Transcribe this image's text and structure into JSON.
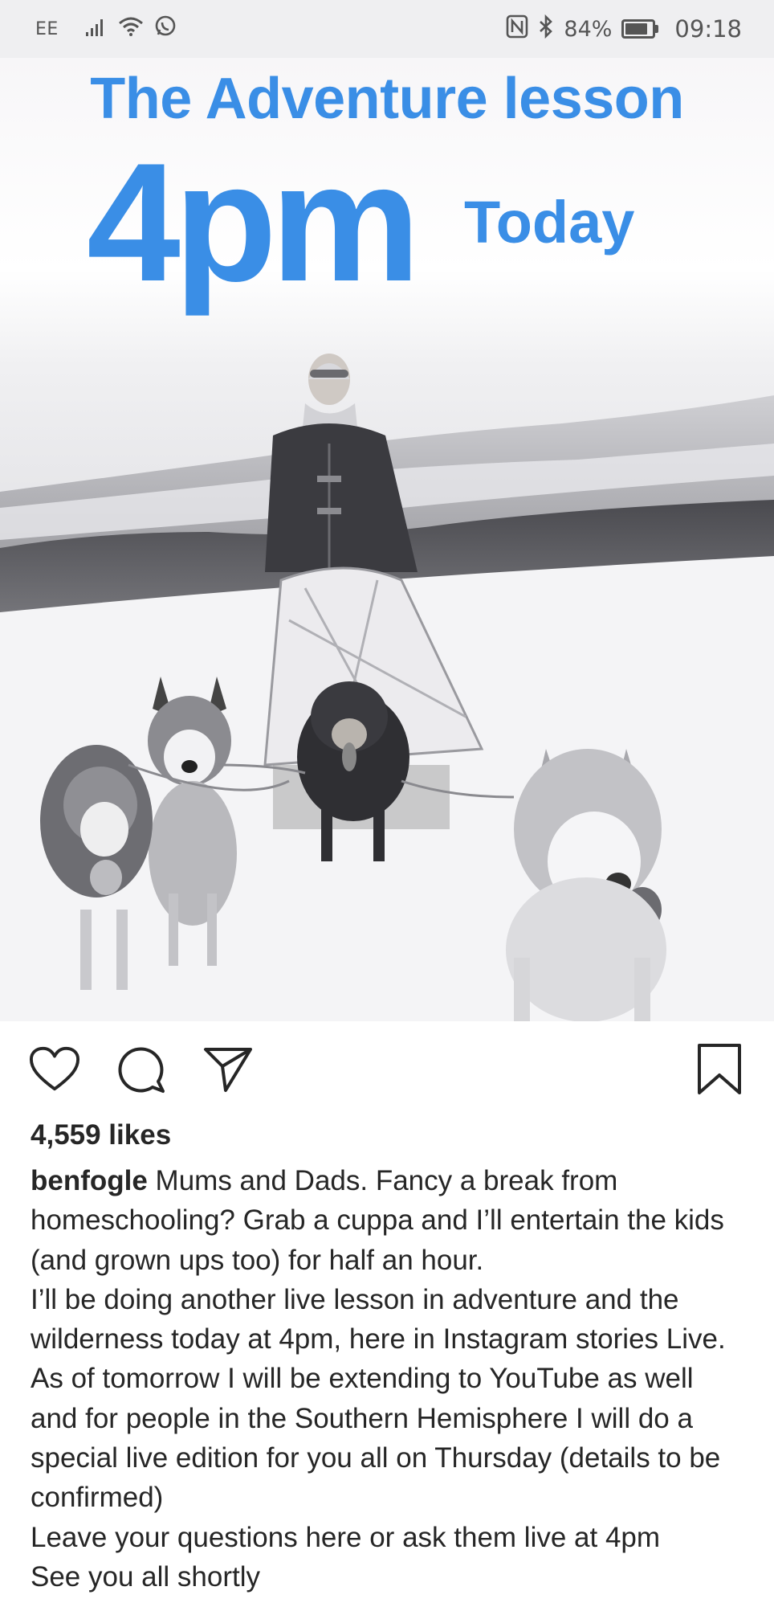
{
  "status_bar": {
    "carrier": "EE",
    "battery_percent": "84%",
    "battery_level": 0.84,
    "time": "09:18",
    "icons": [
      "signal-icon",
      "wifi-icon",
      "whatsapp-icon",
      "nfc-icon",
      "bluetooth-icon",
      "battery-icon"
    ]
  },
  "post": {
    "image": {
      "overlay_title": "The Adventure lesson",
      "overlay_time": "4pm",
      "overlay_today": "Today",
      "scene": "Black-and-white photo of a man on a dog sled pulled by huskies across snow"
    },
    "actions": {
      "like_icon": "heart-icon",
      "comment_icon": "comment-icon",
      "share_icon": "send-icon",
      "save_icon": "bookmark-icon"
    },
    "likes": "4,559 likes",
    "username": "benfogle",
    "caption_first": " Mums and Dads. Fancy a break from homeschooling? Grab a cuppa and I’ll entertain the kids (and grown ups too) for half an hour.",
    "caption_paragraphs": [
      "I’ll be doing another live lesson in adventure and the wilderness today at 4pm, here in Instagram stories Live. As of tomorrow I will be extending to YouTube as well and for people in the Southern Hemisphere I will do a special live edition for you all on Thursday (details to be confirmed)",
      "Leave your questions here or ask them live at 4pm",
      "See you all shortly"
    ]
  },
  "colors": {
    "overlay_blue": "#3a8ee6",
    "text": "#262626",
    "status_bar_bg": "#efeff1"
  }
}
